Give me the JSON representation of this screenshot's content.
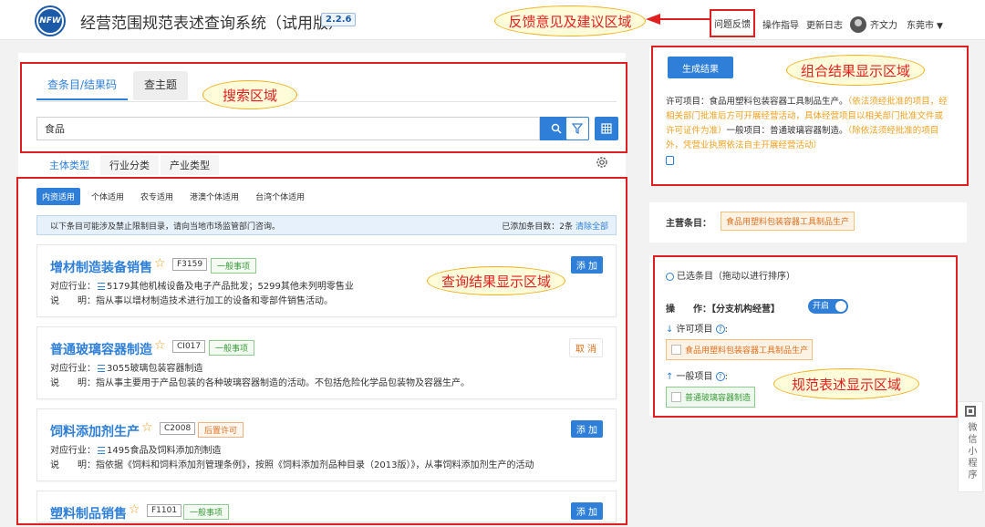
{
  "header": {
    "logo_text": "NFW",
    "title": "经营范围规范表述查询系统（试用版）",
    "version": "2.2.6",
    "nav": {
      "feedback": "问题反馈",
      "guide": "操作指导",
      "changelog": "更新日志",
      "user": "齐文力",
      "city": "东莞市"
    }
  },
  "annotations": {
    "feedback_area": "反馈意见及建议区域",
    "search_area": "搜索区域",
    "query_results_area": "查询结果显示区域",
    "combined_results_area": "组合结果显示区域",
    "standard_area": "规范表述显示区域"
  },
  "search": {
    "tabs": [
      {
        "label": "查条目/结果码",
        "active": true
      },
      {
        "label": "查主题",
        "active": false
      }
    ],
    "query": "食品"
  },
  "subtabs": [
    {
      "label": "主体类型",
      "active": true
    },
    {
      "label": "行业分类",
      "active": false
    },
    {
      "label": "产业类型",
      "active": false
    }
  ],
  "scopes": [
    {
      "label": "内资适用",
      "active": true
    },
    {
      "label": "个体适用",
      "active": false
    },
    {
      "label": "农专适用",
      "active": false
    },
    {
      "label": "港澳个体适用",
      "active": false
    },
    {
      "label": "台湾个体适用",
      "active": false
    }
  ],
  "notice": {
    "text": "以下条目可能涉及禁止限制目录，请向当地市场监管部门咨询。",
    "count_text": "已添加条目数：2条",
    "clear": "清除全部"
  },
  "results": [
    {
      "title": "增材制造装备销售",
      "code": "F3159",
      "type": "一般事项",
      "industry_prefix": "对应行业：",
      "industry": "5179其他机械设备及电子产品批发；5299其他未列明零售业",
      "desc_prefix": "说　　明：",
      "desc": "指从事以增材制造技术进行加工的设备和零部件销售活动。",
      "button": "添 加"
    },
    {
      "title": "普通玻璃容器制造",
      "code": "CI017",
      "type": "一般事项",
      "industry_prefix": "对应行业：",
      "industry": "3055玻璃包装容器制造",
      "desc_prefix": "说　　明：",
      "desc": "指从事主要用于产品包装的各种玻璃容器制造的活动。不包括危险化学品包装物及容器生产。",
      "button": "取 消"
    },
    {
      "title": "饲料添加剂生产",
      "code": "C2008",
      "type": "后置许可",
      "industry_prefix": "对应行业：",
      "industry": "1495食品及饲料添加剂制造",
      "desc_prefix": "说　　明：",
      "desc": "指依据《饲料和饲料添加剂管理条例》，按照《饲料添加剂品种目录（2013版）》，从事饲料添加剂生产的活动",
      "button": "添 加"
    },
    {
      "title": "塑料制品销售",
      "code": "F1101",
      "type": "一般事项",
      "button": "添 加"
    }
  ],
  "combined": {
    "generate_button": "生成结果",
    "licensed_label": "许可项目：",
    "licensed_item": "食品用塑料包装容器工具制品生产。",
    "licensed_note": "（依法须经批准的项目，经相关部门批准后方可开展经营活动，具体经营项目以相关部门批准文件或许可证件为准）",
    "general_label": "一般项目：",
    "general_item": "普通玻璃容器制造。",
    "general_note": "（除依法须经批准的项目外，凭营业执照依法自主开展经营活动）"
  },
  "main_item": {
    "label": "主营条目：",
    "value": "食品用塑料包装容器工具制品生产"
  },
  "selected": {
    "header": "已选条目（拖动以进行排序）",
    "operation_label": "操　　作：【分支机构经营】",
    "toggle": "开启",
    "licensed_section": "许可项目",
    "licensed_chip": "食品用塑料包装容器工具制品生产",
    "general_section": "一般项目",
    "general_chip": "普通玻璃容器制造"
  },
  "mini_program": "微信小程序",
  "colors": {
    "primary": "#2f7fd8",
    "annotation_red": "#e02020",
    "orange": "#e07020",
    "green": "#3a9a3a"
  }
}
